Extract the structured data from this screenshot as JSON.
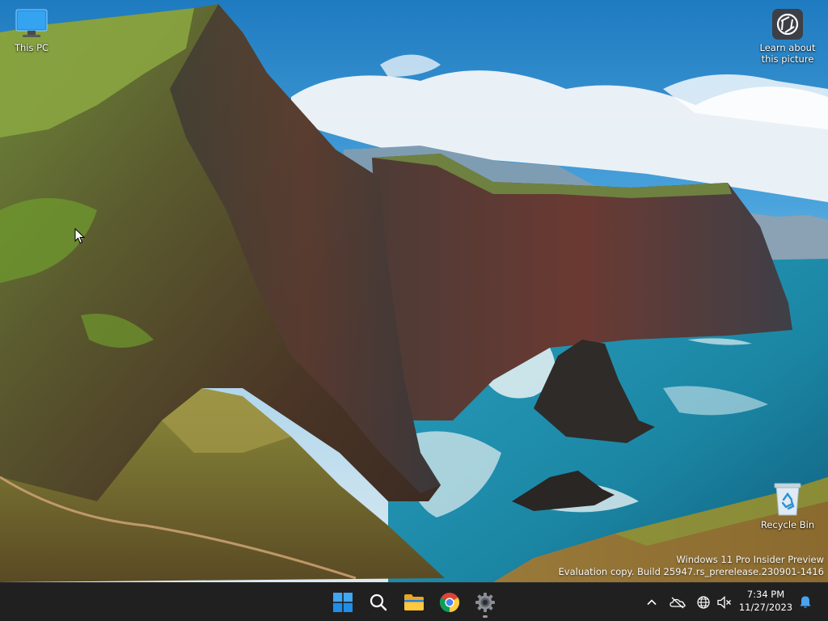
{
  "desktop": {
    "icons": [
      {
        "label": "This PC"
      },
      {
        "label": "Learn about this picture"
      },
      {
        "label": "Recycle Bin"
      }
    ]
  },
  "watermark": {
    "line1": "Windows 11 Pro Insider Preview",
    "line2": "Evaluation copy. Build 25947.rs_prerelease.230901-1416"
  },
  "taskbar": {
    "apps": [
      {
        "icon": "windows-start-icon"
      },
      {
        "icon": "search-icon"
      },
      {
        "icon": "file-explorer-icon"
      },
      {
        "icon": "chrome-icon"
      },
      {
        "icon": "settings-gear-icon"
      }
    ],
    "tray": {
      "time": "7:34 PM",
      "date": "11/27/2023"
    }
  },
  "colors": {
    "taskbar_bg": "#202020",
    "accent_blue": "#3a8ee6",
    "sky_top": "#1f7fc4",
    "sea": "#1d8ea8"
  }
}
